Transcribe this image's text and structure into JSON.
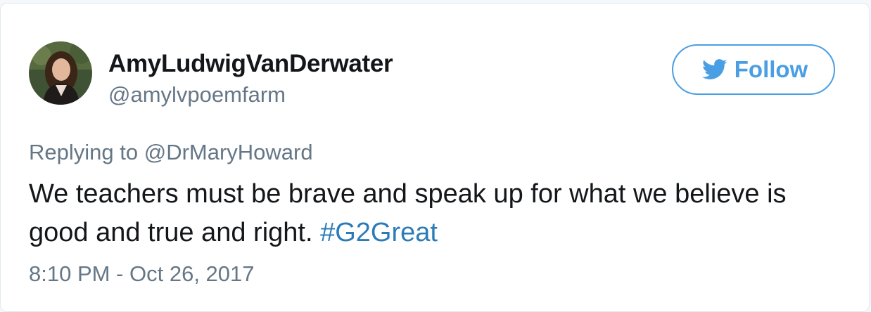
{
  "user": {
    "display_name": "AmyLudwigVanDerwater",
    "handle": "@amylvpoemfarm"
  },
  "follow_button": {
    "label": "Follow",
    "icon": "twitter-bird-icon"
  },
  "reply": {
    "prefix": "Replying to",
    "target": "@DrMaryHoward"
  },
  "tweet": {
    "text_line1": "We teachers must be brave and speak up for what we believe is",
    "text_line2": "good and true and right.",
    "hashtag": "#G2Great"
  },
  "timestamp": "8:10 PM - Oct 26, 2017",
  "colors": {
    "accent": "#4a9ee3",
    "hashtag": "#2b7bb9",
    "muted": "#657786",
    "text": "#14171a"
  }
}
